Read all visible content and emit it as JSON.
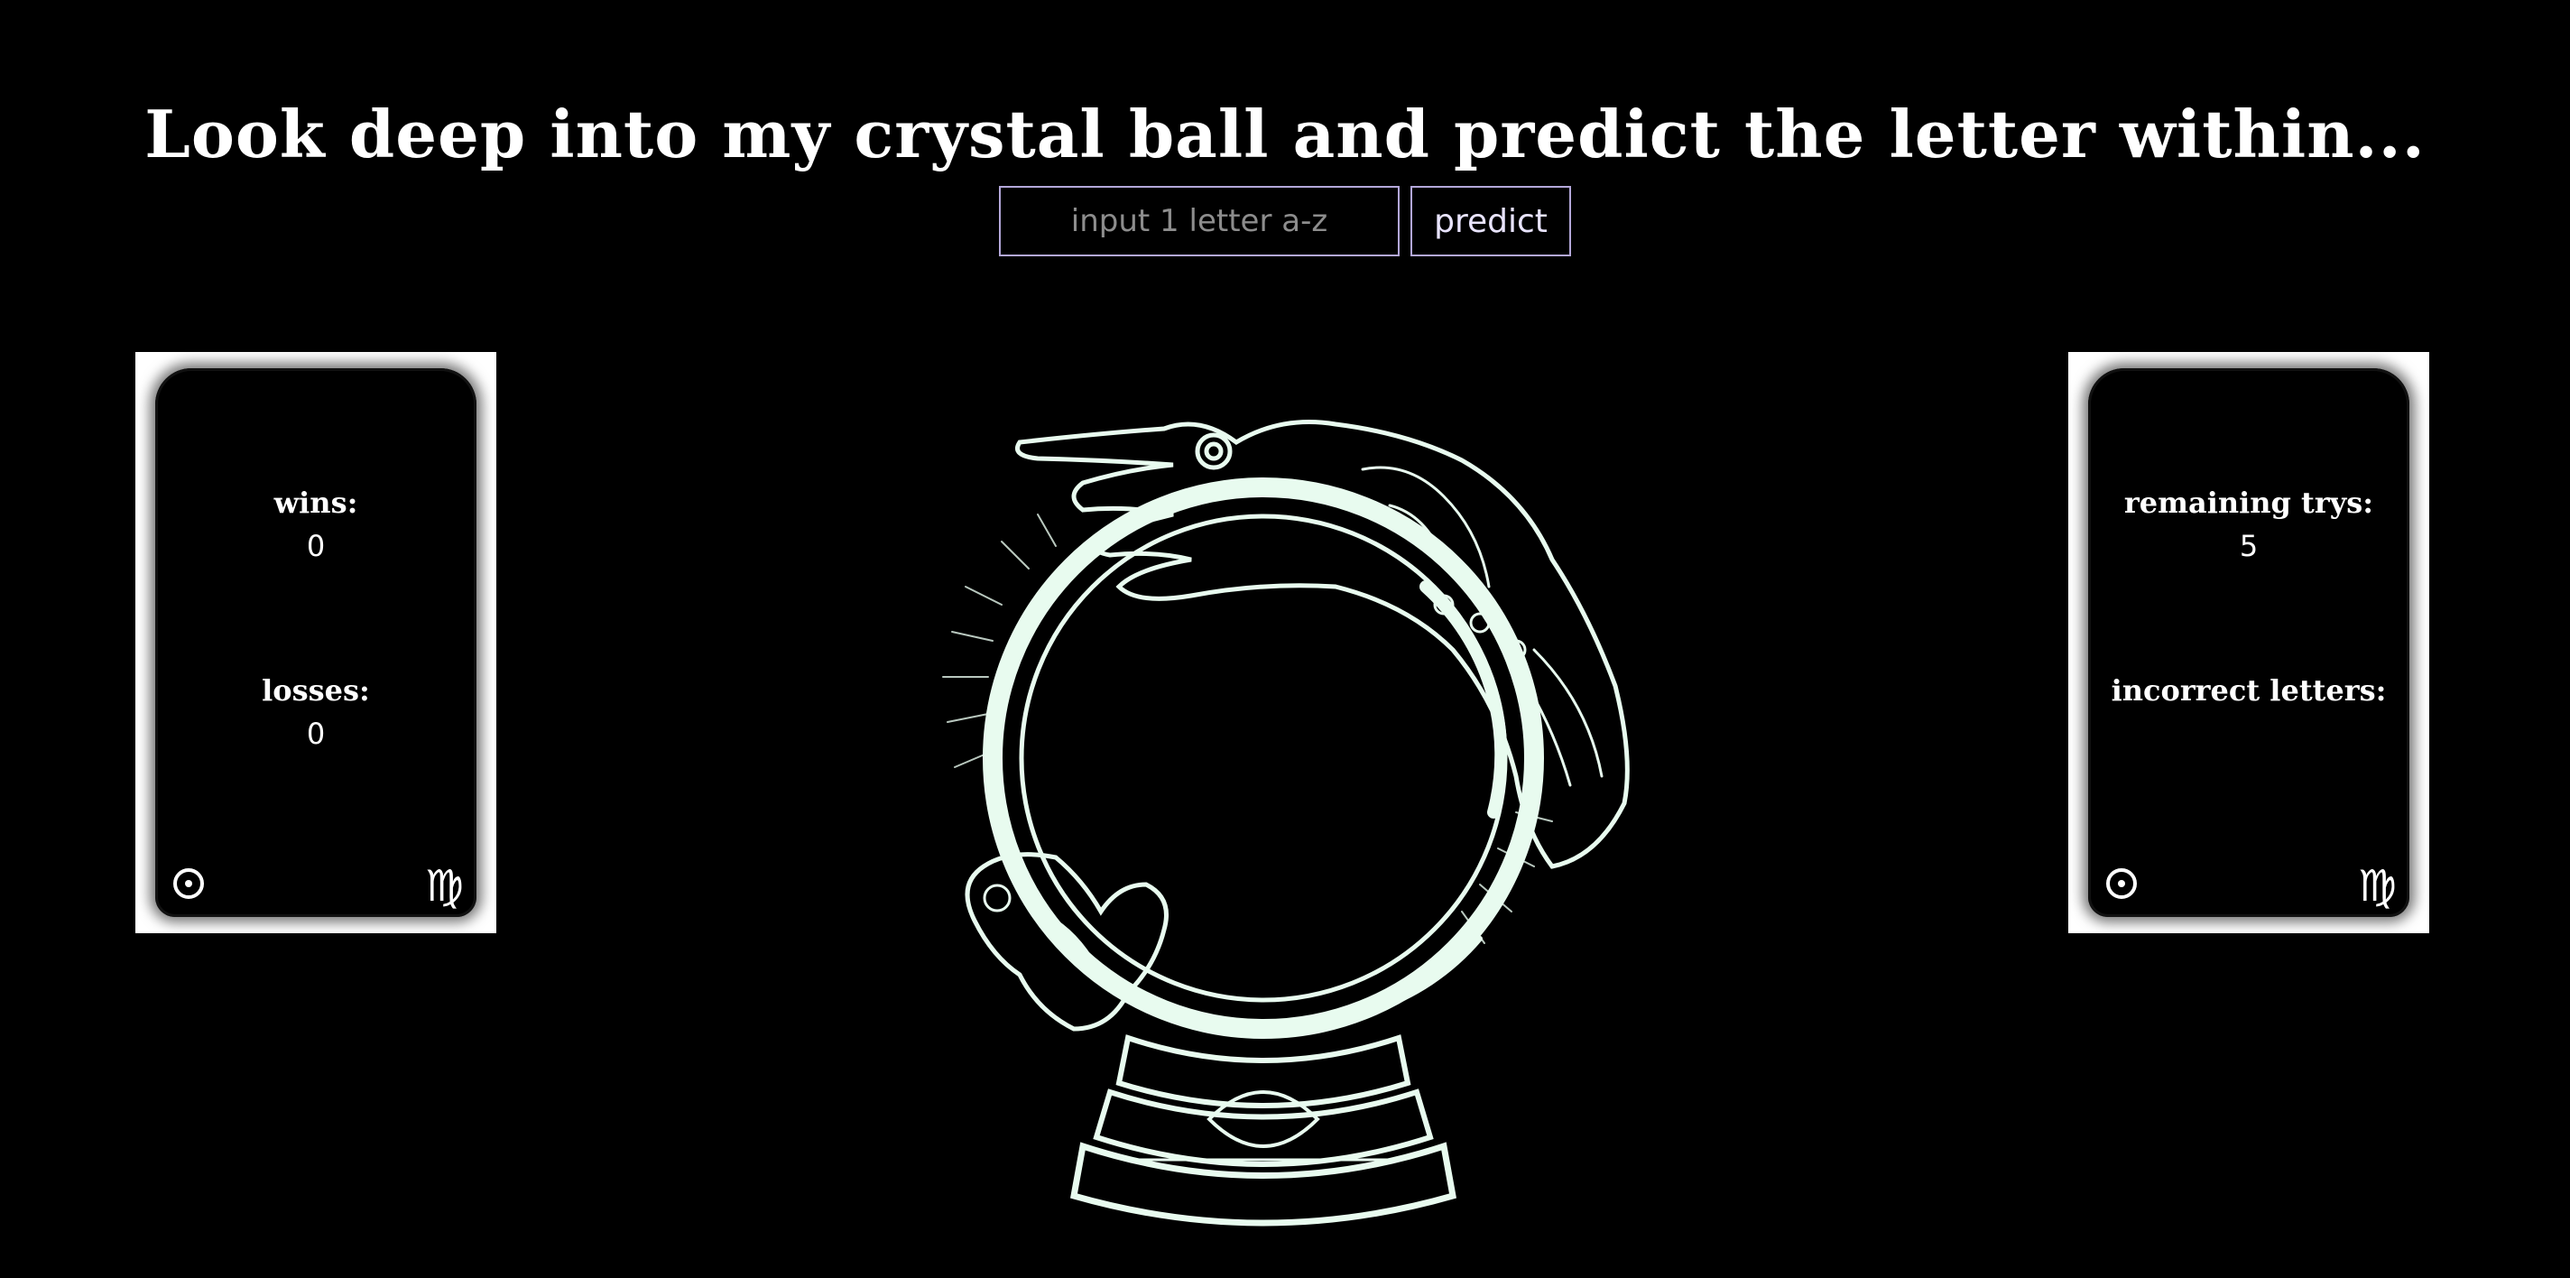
{
  "header": {
    "title": "Look deep into my crystal ball and predict the letter within..."
  },
  "form": {
    "input_value": "",
    "input_placeholder": "input 1 letter a-z",
    "predict_label": "predict"
  },
  "score_card": {
    "wins_label": "wins:",
    "wins_value": "0",
    "losses_label": "losses:",
    "losses_value": "0",
    "corner_icons": [
      "sun-icon",
      "virgo-icon"
    ]
  },
  "status_card": {
    "remaining_label": "remaining trys:",
    "remaining_value": "5",
    "incorrect_label": "incorrect letters:",
    "incorrect_value": "",
    "corner_icons": [
      "sun-icon",
      "virgo-icon"
    ]
  },
  "illustration": {
    "name": "crystal-ball-with-hand",
    "line_color": "#e8fbef"
  },
  "colors": {
    "background": "#000000",
    "input_border": "#b3a7d9",
    "card_frame": "#ffffff"
  }
}
